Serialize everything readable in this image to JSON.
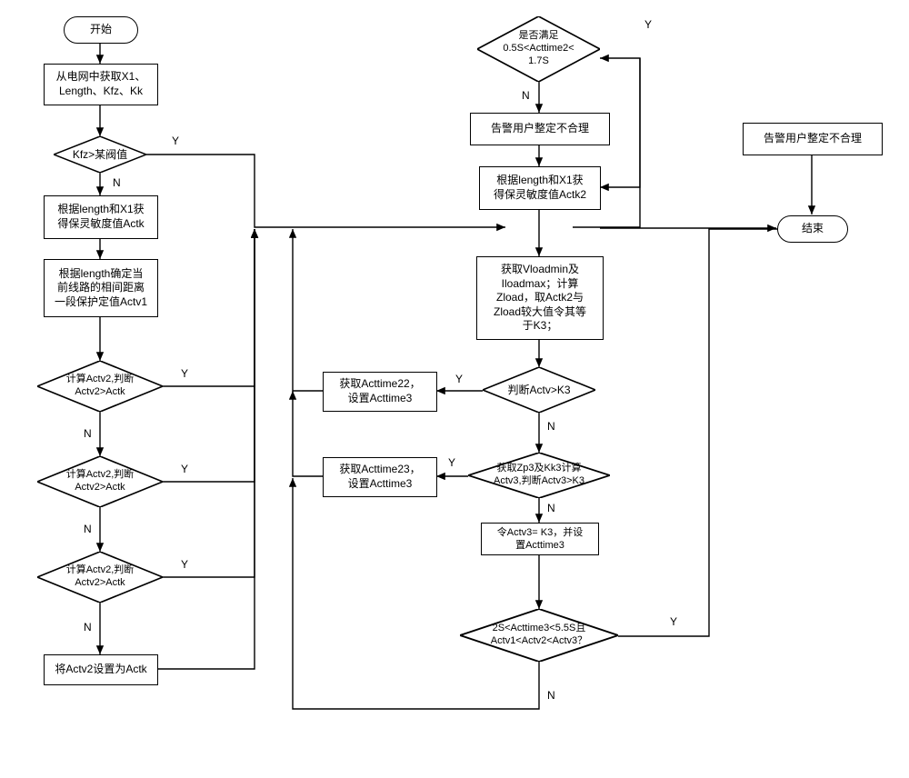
{
  "nodes": {
    "start": "开始",
    "p_fetch": "从电网中获取X1、\nLength、Kfz、Kk",
    "d_kfz": "Kfz>某阀值",
    "p_actk": "根据length和X1获\n得保灵敏度值Actk",
    "p_actv1": "根据length确定当\n前线路的相间距离\n一段保护定值Actv1",
    "d_actv2_1": "计算Actv2,判断\nActv2>Actk",
    "d_actv2_2": "计算Actv2,判断\nActv2>Actk",
    "d_actv2_3": "计算Actv2,判断\nActv2>Actk",
    "p_set_actk": "将Actv2设置为Actk",
    "d_time2": "是否满足\n0.5S<Acttime2<\n1.7S",
    "p_warn1": "告警用户整定不合理",
    "p_actk2": "根据length和X1获\n得保灵敏度值Actk2",
    "p_vload": "获取Vloadmin及\nIloadmax；计算\nZload，取Actk2与\nZload较大值令其等\n于K3；",
    "d_actv_k3": "判断Actv>K3",
    "p_time22": "获取Acttime22，\n设置Acttime3",
    "d_zp3": "获取Zp3及Kk3计算\nActv3,判断Actv3>K3",
    "p_time23": "获取Acttime23，\n设置Acttime3",
    "p_actv3_k3": "令Actv3= K3，并设\n置Acttime3",
    "d_final": "2S<Acttime3<5.5S且\nActv1<Actv2<Actv3？",
    "p_warn2": "告警用户整定不合理",
    "end": "结束"
  },
  "edge_labels": {
    "Y": "Y",
    "N": "N"
  }
}
